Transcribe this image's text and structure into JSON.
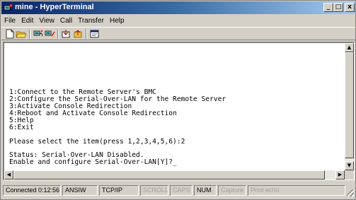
{
  "window": {
    "title": "mine - HyperTerminal",
    "minimize_label": "_",
    "maximize_label": "□",
    "close_label": "x"
  },
  "menu": {
    "items": [
      "File",
      "Edit",
      "View",
      "Call",
      "Transfer",
      "Help"
    ]
  },
  "toolbar": {
    "buttons": [
      "new-icon",
      "open-icon",
      "connect-icon",
      "disconnect-icon",
      "send-icon",
      "receive-icon",
      "properties-icon"
    ]
  },
  "terminal": {
    "lines": [
      "1:Connect to the Remote Server's BMC",
      "2:Configure the Serial-Over-LAN for the Remote Server",
      "3:Activate Console Redirection",
      "4:Reboot and Activate Console Redirection",
      "5:Help",
      "6:Exit",
      "",
      "Please select the item(press 1,2,3,4,5,6):2",
      "",
      "Status: Serial-Over-LAN Disabled.",
      "Enable and configure Serial-Over-LAN[Y]?_"
    ]
  },
  "status": {
    "connected": "Connected 0:12:56",
    "emulation": "ANSIW",
    "protocol": "TCP/IP",
    "scroll": "SCROLL",
    "caps": "CAPS",
    "num": "NUM",
    "capture": "Capture",
    "print_echo": "Print echo"
  }
}
